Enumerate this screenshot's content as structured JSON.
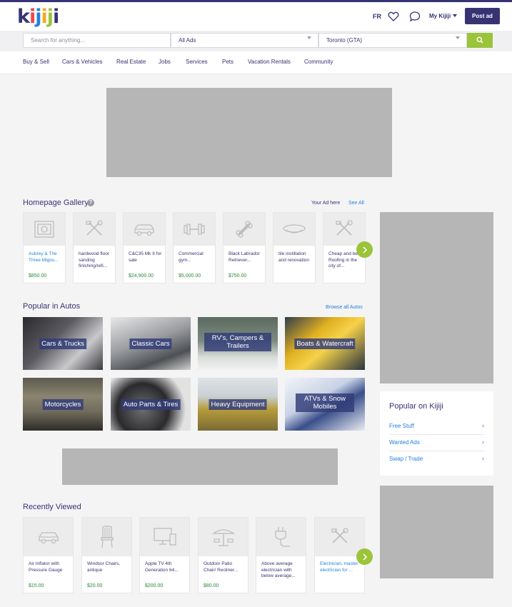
{
  "header": {
    "logo": [
      "k",
      "i",
      "j",
      "i",
      "j",
      "i"
    ],
    "lang": "FR",
    "my_kijiji": "My Kijiji",
    "post_ad": "Post ad",
    "colors": {
      "brand": "#373373",
      "accent_green": "#9bc43b",
      "link": "#2681db"
    }
  },
  "search": {
    "placeholder": "Search for anything...",
    "category": "All Ads",
    "location": "Toronto (GTA)"
  },
  "nav": [
    "Buy & Sell",
    "Cars & Vehicles",
    "Real Estate",
    "Jobs",
    "Services",
    "Pets",
    "Vacation Rentals",
    "Community"
  ],
  "gallery": {
    "title": "Homepage Gallery",
    "info": "?",
    "your_ad": "Your Ad here",
    "see_all": "See All",
    "items": [
      {
        "title": "Aubrey & The Three Migos...",
        "price": "$850.00",
        "icon": "ticket-icon"
      },
      {
        "title": "hardwood floor sanding finishing/refi...",
        "price": "",
        "icon": "tools-icon"
      },
      {
        "title": "C&C35 Mk II for sale",
        "price": "$24,900.00",
        "icon": "car-icon"
      },
      {
        "title": "Commercial gym...",
        "price": "$5,000.00",
        "icon": "dumbbell-icon"
      },
      {
        "title": "Black Labrador Retriever...",
        "price": "$750.00",
        "icon": "bone-icon"
      },
      {
        "title": "tile instillation and renovation",
        "price": "",
        "icon": "dish-icon"
      },
      {
        "title": "Cheap and best Roofing in the city of...",
        "price": "",
        "icon": "tools-icon"
      }
    ]
  },
  "autos": {
    "title": "Popular in Autos",
    "browse": "Browse all Autos",
    "tiles": [
      "Cars & Trucks",
      "Classic Cars",
      "RV's, Campers & Trailers",
      "Boats & Watercraft",
      "Motorcycles",
      "Auto Parts & Tires",
      "Heavy Equipment",
      "ATVs & Snow Mobiles"
    ]
  },
  "popular": {
    "title": "Popular on Kijiji",
    "items": [
      "Free Stuff",
      "Wanted Ads",
      "Swap / Trade"
    ]
  },
  "recent": {
    "title": "Recently Viewed",
    "items": [
      {
        "title": "Air Inflator with Pressure Gauge",
        "price": "$15.00",
        "icon": "car-icon"
      },
      {
        "title": "Windsor Chairs, antique",
        "price": "$20.00",
        "icon": "chair-icon"
      },
      {
        "title": "Apple TV 4th Generation 64...",
        "price": "$200.00",
        "icon": "devices-icon"
      },
      {
        "title": "Outdoor Patio Chair/ Recliner...",
        "price": "$80.00",
        "icon": "patio-icon"
      },
      {
        "title": "Above average electrician with below average...",
        "price": "",
        "icon": "plug-icon"
      },
      {
        "title": "Electrician, master electrician for ...",
        "price": "",
        "icon": "tools-icon"
      }
    ]
  }
}
